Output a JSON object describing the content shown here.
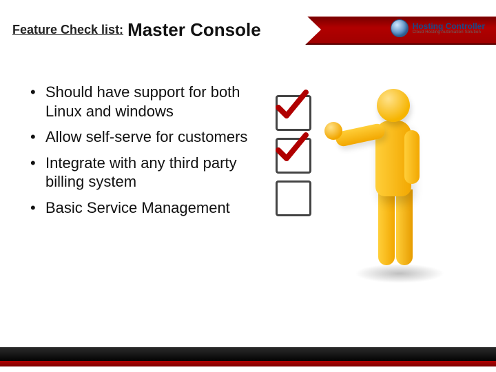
{
  "header": {
    "prefix": "Feature Check list:",
    "main": "Master Console"
  },
  "logo": {
    "name": "Hosting Controller",
    "tagline": "Cloud Hosting Automation Solution"
  },
  "bullets": [
    "Should have support for both Linux and windows",
    "Allow self-serve for customers",
    "Integrate with any third party billing system",
    "Basic Service Management"
  ],
  "checklist": {
    "box1_checked": true,
    "box2_checked": true,
    "box3_checked": false
  }
}
